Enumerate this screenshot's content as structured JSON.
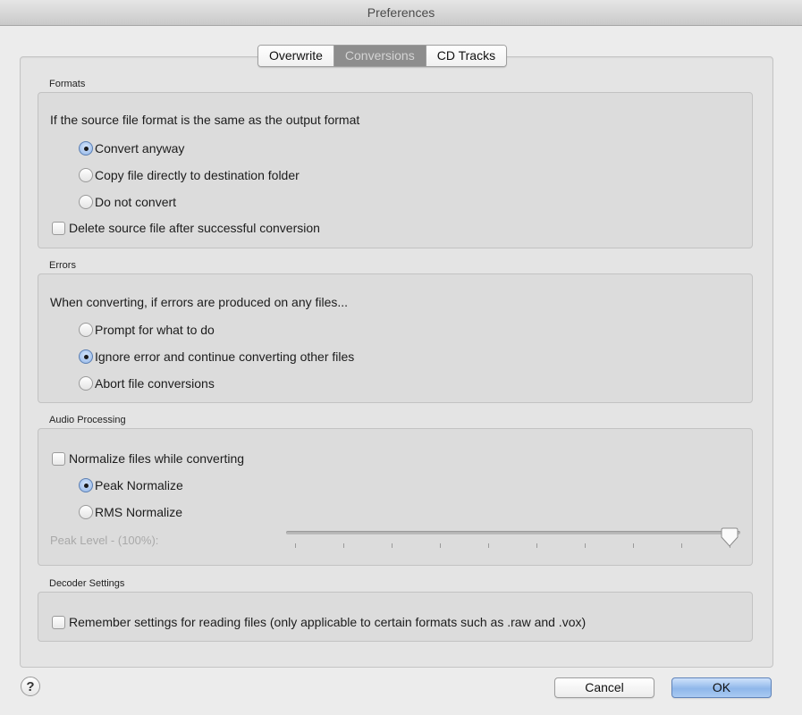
{
  "window": {
    "title": "Preferences"
  },
  "tabs": [
    {
      "label": "Overwrite",
      "active": false
    },
    {
      "label": "Conversions",
      "active": true
    },
    {
      "label": "CD Tracks",
      "active": false
    }
  ],
  "formats": {
    "section_label": "Formats",
    "prompt": "If the source file format is the same as the output format",
    "options": [
      {
        "label": "Convert anyway",
        "selected": true
      },
      {
        "label": "Copy file directly to destination folder",
        "selected": false
      },
      {
        "label": "Do not convert",
        "selected": false
      }
    ],
    "delete_source": {
      "label": "Delete source file after successful conversion",
      "checked": false
    }
  },
  "errors": {
    "section_label": "Errors",
    "prompt": "When converting, if errors are produced on any files...",
    "options": [
      {
        "label": "Prompt for what to do",
        "selected": false
      },
      {
        "label": "Ignore error and continue converting other files",
        "selected": true
      },
      {
        "label": "Abort file conversions",
        "selected": false
      }
    ]
  },
  "audio_processing": {
    "section_label": "Audio Processing",
    "normalize": {
      "label": "Normalize files while converting",
      "checked": false
    },
    "options": [
      {
        "label": "Peak Normalize",
        "selected": true
      },
      {
        "label": "RMS Normalize",
        "selected": false
      }
    ],
    "peak_level": {
      "label": "Peak Level - (100%):",
      "value_percent": 100,
      "tick_count": 10,
      "enabled": false
    }
  },
  "decoder_settings": {
    "section_label": "Decoder Settings",
    "remember": {
      "label": "Remember settings for reading files (only applicable to certain formats such as .raw and .vox)",
      "checked": false
    }
  },
  "footer": {
    "help_label": "?",
    "cancel_label": "Cancel",
    "ok_label": "OK"
  }
}
